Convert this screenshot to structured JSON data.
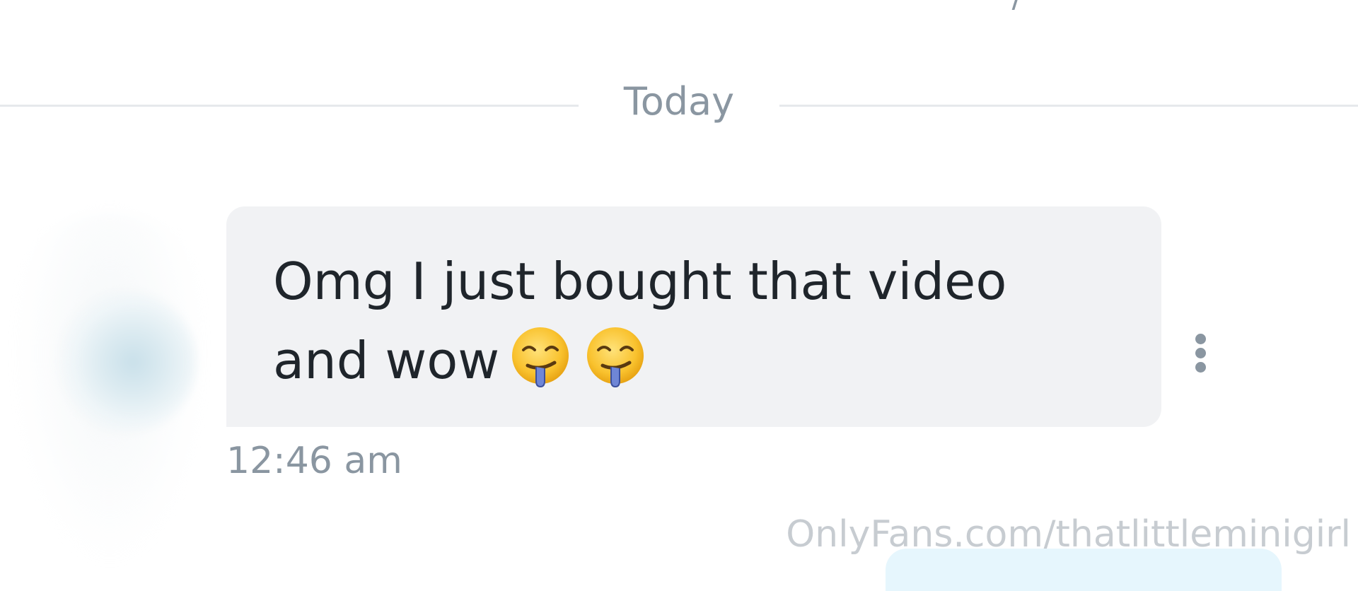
{
  "top": {
    "partial_text": "' '   '  ' /"
  },
  "divider": {
    "label": "Today"
  },
  "message": {
    "line1": "Omg I just bought that video",
    "line2_text": "and wow",
    "emojis": [
      "drooling-face",
      "drooling-face"
    ],
    "time": "12:46 am"
  },
  "watermark": {
    "text": "OnlyFans.com/thatlittleminigirl"
  },
  "colors": {
    "bubble_bg": "#f1f2f4",
    "text": "#1f252b",
    "muted": "#8a96a1",
    "divider": "#e6e9ec",
    "watermark": "#c7ccd1",
    "next_bubble": "#e6f6fd"
  }
}
